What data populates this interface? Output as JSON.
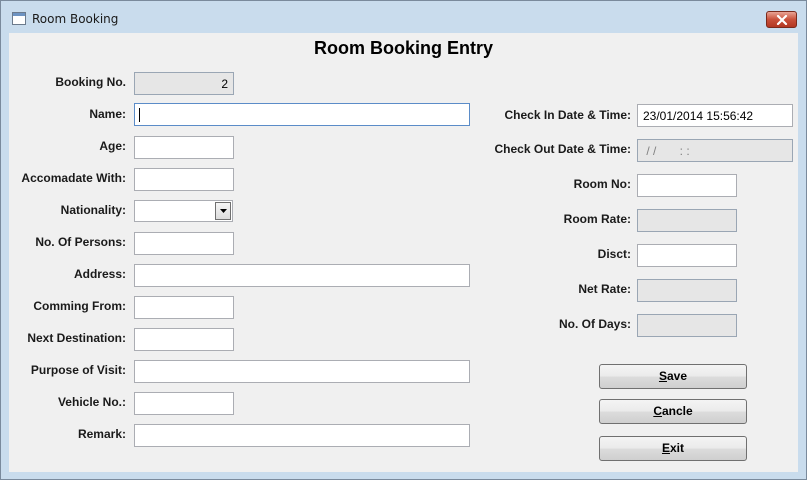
{
  "window": {
    "title": "Room Booking"
  },
  "form": {
    "title": "Room Booking Entry"
  },
  "left": {
    "booking_no": {
      "label": "Booking No.",
      "value": "2"
    },
    "name": {
      "label": "Name:",
      "value": ""
    },
    "age": {
      "label": "Age:",
      "value": ""
    },
    "accomodate": {
      "label": "Accomadate With:",
      "value": ""
    },
    "nationality": {
      "label": "Nationality:",
      "value": ""
    },
    "persons": {
      "label": "No. Of Persons:",
      "value": ""
    },
    "address": {
      "label": "Address:",
      "value": ""
    },
    "coming_from": {
      "label": "Comming From:",
      "value": ""
    },
    "next_dest": {
      "label": "Next Destination:",
      "value": ""
    },
    "purpose": {
      "label": "Purpose of Visit:",
      "value": ""
    },
    "vehicle": {
      "label": "Vehicle No.:",
      "value": ""
    },
    "remark": {
      "label": "Remark:",
      "value": ""
    }
  },
  "right": {
    "check_in": {
      "label": "Check In Date & Time:",
      "value": "23/01/2014 15:56:42"
    },
    "check_out": {
      "label": "Check Out Date & Time:",
      "value": " / /       : :"
    },
    "room_no": {
      "label": "Room No:",
      "value": ""
    },
    "room_rate": {
      "label": "Room Rate:",
      "value": ""
    },
    "disct": {
      "label": "Disct:",
      "value": ""
    },
    "net_rate": {
      "label": "Net Rate:",
      "value": ""
    },
    "days": {
      "label": "No. Of Days:",
      "value": ""
    }
  },
  "buttons": {
    "save": {
      "hotkey": "S",
      "rest": "ave"
    },
    "cancel": {
      "hotkey": "C",
      "rest": "ancle"
    },
    "exit": {
      "hotkey": "E",
      "rest": "xit"
    }
  },
  "icons": {
    "window": "window-icon",
    "close": "close-icon",
    "dropdown": "chevron-down-icon"
  },
  "colors": {
    "frame": "#c9dced",
    "client": "#f0f0f0",
    "close": "#c9503a"
  }
}
